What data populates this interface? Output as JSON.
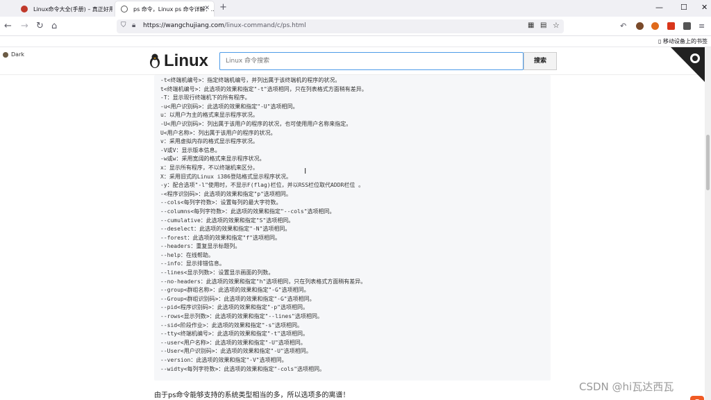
{
  "tabs": [
    {
      "label": "Linux命令大全(手册) – 真正好用…"
    },
    {
      "label": "ps 命令，Linux ps 命令详解：…"
    }
  ],
  "window_controls": {
    "min": "—",
    "max": "☐",
    "close": "✕"
  },
  "nav": {
    "url_host": "https://wangchujiang.com",
    "url_rest": "/linux-command/c/ps.html"
  },
  "bookmarks": {
    "mobile": "移动设备上的书签"
  },
  "page": {
    "dark_label": "Dark",
    "logo": "Linux",
    "search_placeholder": "Linux 命令搜索",
    "search_button": "搜索",
    "code_lines": [
      "-t<终端机编号>：指定终端机编号，并列出属于该终端机的程序的状况。",
      "t<终端机编号>：此选项的效果和指定\"-t\"选项相同，只在列表格式方面稍有差异。",
      "-T：显示现行终端机下的所有程序。",
      "-u<用户识别码>：此选项的效果和指定\"-U\"选项相同。",
      "u：以用户为主的格式来显示程序状况。",
      "-U<用户识别码>：列出属于该用户的程序的状况，也可使用用户名称来指定。",
      "U<用户名称>：列出属于该用户的程序的状况。",
      "v：采用虚拟内存的格式显示程序状况。",
      "-V或V：显示版本信息。",
      "-w或w：采用宽阔的格式来显示程序状况。",
      "x：显示所有程序，不以终端机来区分。",
      "X：采用旧式的Linux i386登陆格式显示程序状况。",
      "-y：配合选项\"-l\"使用时，不显示F(flag)栏位，并以RSS栏位取代ADDR栏位 。",
      "-<程序识别码>：此选项的效果和指定\"p\"选项相同。",
      "--cols<每列字符数>：设置每列的最大字符数。",
      "--columns<每列字符数>：此选项的效果和指定\"--cols\"选项相同。",
      "--cumulative：此选项的效果和指定\"S\"选项相同。",
      "--deselect：此选项的效果和指定\"-N\"选项相同。",
      "--forest：此选项的效果和指定\"f\"选项相同。",
      "--headers：重复显示标题列。",
      "--help：在线帮助。",
      "--info：显示排错信息。",
      "--lines<显示列数>：设置显示画面的列数。",
      "--no-headers：此选项的效果和指定\"h\"选项相同，只在列表格式方面稍有差异。",
      "--group<群组名称>：此选项的效果和指定\"-G\"选项相同。",
      "--Group<群组识别码>：此选项的效果和指定\"-G\"选项相同。",
      "--pid<程序识别码>：此选项的效果和指定\"-p\"选项相同。",
      "--rows<显示列数>：此选项的效果和指定\"--lines\"选项相同。",
      "--sid<阶段作业>：此选项的效果和指定\"-s\"选项相同。",
      "--tty<终端机编号>：此选项的效果和指定\"-t\"选项相同。",
      "--user<用户名称>：此选项的效果和指定\"-U\"选项相同。",
      "--User<用户识别码>：此选项的效果和指定\"-U\"选项相同。",
      "--version：此选项的效果和指定\"-V\"选项相同。",
      "--widty<每列字符数>：此选项的效果和指定\"-cols\"选项相同。"
    ],
    "paragraph": "由于ps命令能够支持的系统类型相当的多，所以选项多的离谱！"
  },
  "watermark": "CSDN @hi瓦达西瓦",
  "ime_label": "S",
  "colors": {
    "accent": "#4c9be8",
    "corner": "#222222"
  }
}
